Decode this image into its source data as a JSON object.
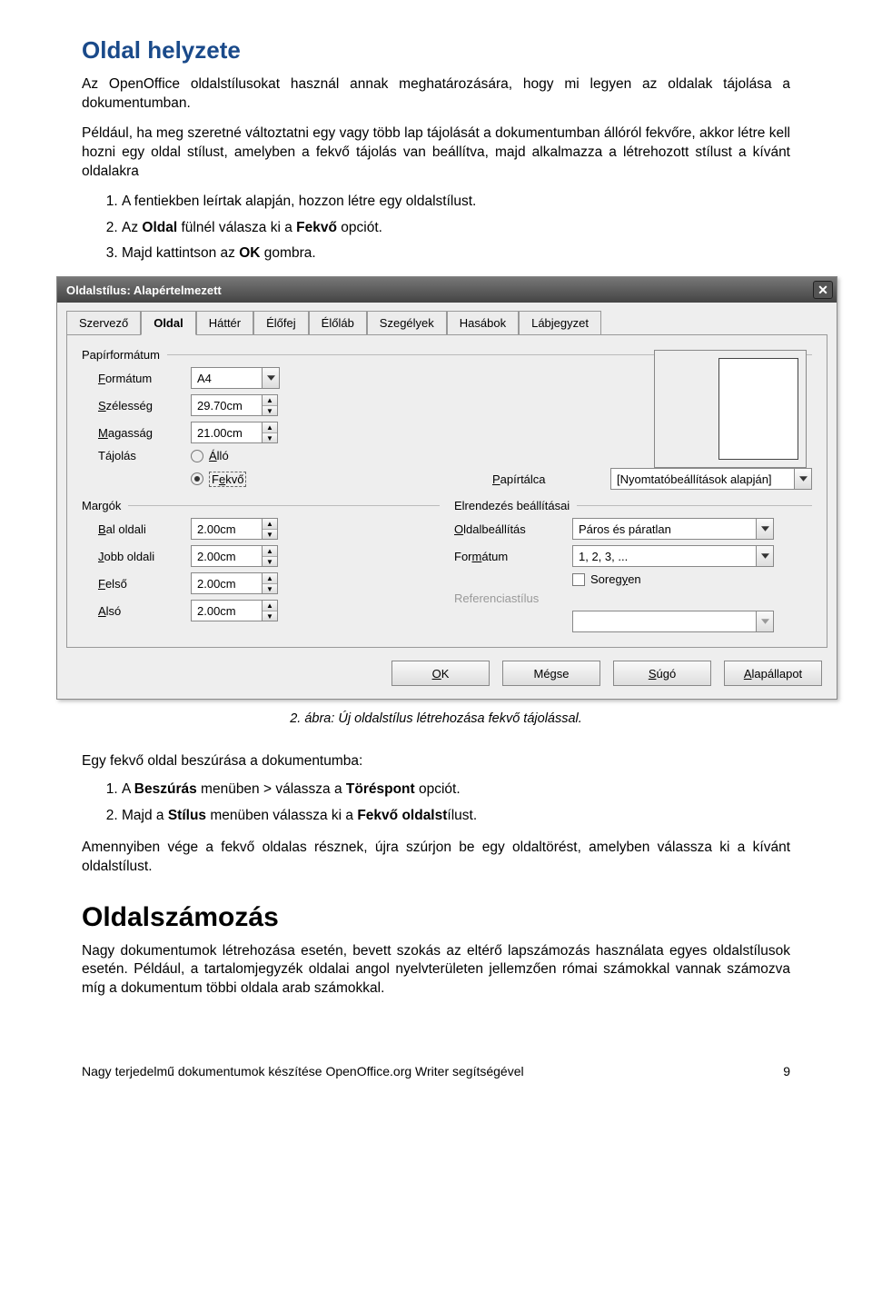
{
  "doc": {
    "section_title": "Oldal helyzete",
    "intro": "Az OpenOffice oldalstílusokat használ annak meghatározására, hogy mi legyen az oldalak tájolása a dokumentumban.",
    "para2": "Például, ha meg szeretné változtatni egy vagy több lap tájolását a dokumentumban állóról fekvőre, akkor létre kell hozni egy oldal stílust, amelyben a fekvő tájolás van beállítva, majd alkalmazza a létrehozott stílust a kívánt oldalakra",
    "list1": {
      "i1": "A fentiekben leírtak alapján, hozzon létre egy oldalstílust.",
      "i2a": "Az ",
      "i2b": "Oldal",
      "i2c": " fülnél válasza ki a ",
      "i2d": "Fekvő",
      "i2e": " opciót.",
      "i3a": "Majd kattintson az ",
      "i3b": "OK",
      "i3c": " gombra."
    },
    "caption": "2. ábra: Új oldalstílus létrehozása fekvő tájolással.",
    "subhead": "Egy fekvő oldal beszúrása a dokumentumba:",
    "list2": {
      "i1a": "A ",
      "i1b": "Beszúrás",
      "i1c": " menüben > válassza a ",
      "i1d": "Töréspont",
      "i1e": " opciót.",
      "i2a": "Majd a ",
      "i2b": "Stílus",
      "i2c": " menüben válassza ki a ",
      "i2d": "Fekvő oldalst",
      "i2e": "ílust."
    },
    "para3": "Amennyiben vége a fekvő oldalas résznek, újra szúrjon be egy oldaltörést, amelyben válassza ki a kívánt oldalstílust.",
    "section2_title": "Oldalszámozás",
    "para4": "Nagy dokumentumok létrehozása esetén, bevett szokás az eltérő lapszámozás használata egyes oldalstílusok esetén. Például, a tartalomjegyzék oldalai angol nyelvterületen jellemzően római számokkal vannak számozva míg a dokumentum többi oldala arab számokkal.",
    "footer_left": "Nagy terjedelmű dokumentumok készítése OpenOffice.org Writer segítségével",
    "footer_right": "9"
  },
  "dialog": {
    "title": "Oldalstílus: Alapértelmezett",
    "tabs": [
      "Szervező",
      "Oldal",
      "Háttér",
      "Élőfej",
      "Élőláb",
      "Szegélyek",
      "Hasábok",
      "Lábjegyzet"
    ],
    "active_tab": 1,
    "group_paper": "Papírformátum",
    "lbl_format": "Formátum",
    "val_format": "A4",
    "lbl_width": "Szélesség",
    "val_width": "29.70cm",
    "lbl_height": "Magasság",
    "val_height": "21.00cm",
    "lbl_orient": "Tájolás",
    "radio_portrait": "Álló",
    "radio_landscape": "Fekvő",
    "lbl_tray": "Papírtálca",
    "val_tray": "[Nyomtatóbeállítások alapján]",
    "group_margins": "Margók",
    "lbl_left": "Bal oldali",
    "val_left": "2.00cm",
    "lbl_right": "Jobb oldali",
    "val_right": "2.00cm",
    "lbl_top": "Felső",
    "val_top": "2.00cm",
    "lbl_bottom": "Alsó",
    "val_bottom": "2.00cm",
    "group_layout": "Elrendezés beállításai",
    "lbl_pagelayout": "Oldalbeállítás",
    "val_pagelayout": "Páros és páratlan",
    "lbl_format2": "Formátum",
    "val_format2": "1, 2, 3, ...",
    "chk_register": "Soregyen",
    "lbl_refstyle": "Referenciastílus",
    "val_refstyle": "",
    "btn_ok": "OK",
    "btn_cancel": "Mégse",
    "btn_help": "Súgó",
    "btn_reset": "Alapállapot"
  }
}
